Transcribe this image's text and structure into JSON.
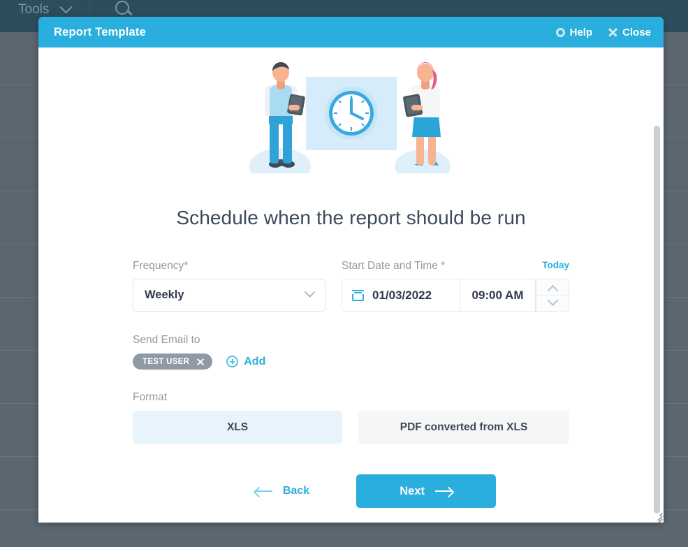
{
  "background": {
    "nav": {
      "tools_label": "Tools",
      "chevron_icon": "chevron-down-icon",
      "search_icon": "search-icon"
    },
    "row_count": 9
  },
  "modal": {
    "title": "Report Template",
    "help_label": "Help",
    "help_icon": "lifebuoy-icon",
    "close_label": "Close",
    "close_icon": "close-x-icon",
    "illustration": {
      "name": "schedule-clock-illustration",
      "alt": "Two people standing beside a wall clock"
    },
    "heading": "Schedule when the report should be run",
    "frequency": {
      "label": "Frequency",
      "required_mark": "*",
      "value": "Weekly",
      "chevron_icon": "chevron-down-icon"
    },
    "start_datetime": {
      "label": "Start Date and Time",
      "required_mark": "*",
      "today_label": "Today",
      "date_value": "01/03/2022",
      "time_value": "09:00 AM",
      "calendar_icon": "calendar-icon",
      "spinner_up_icon": "chevron-up-icon",
      "spinner_down_icon": "chevron-down-icon"
    },
    "send_email": {
      "label": "Send Email to",
      "tags": [
        {
          "label": "TEST USER",
          "remove_icon": "close-x-icon"
        }
      ],
      "add_label": "Add",
      "add_icon": "plus-circle-icon"
    },
    "format": {
      "label": "Format",
      "options": [
        {
          "label": "XLS",
          "selected": true
        },
        {
          "label": "PDF converted from XLS",
          "selected": false
        }
      ]
    },
    "footer": {
      "back_label": "Back",
      "back_icon": "arrow-left-icon",
      "next_label": "Next",
      "next_icon": "arrow-right-icon"
    },
    "scrollbar": {
      "name": "modal-scrollbar"
    },
    "resize_grip": {
      "name": "resize-grip"
    }
  },
  "colors": {
    "accent": "#29aede",
    "navbar": "#2d4d5c",
    "overlay": "#5b6670",
    "selected_card": "#e8f4fb",
    "unselected_card": "#f5f6f7",
    "tag": "#8f9aa5",
    "heading_text": "#3d4a5c",
    "label_text": "#93999f"
  }
}
